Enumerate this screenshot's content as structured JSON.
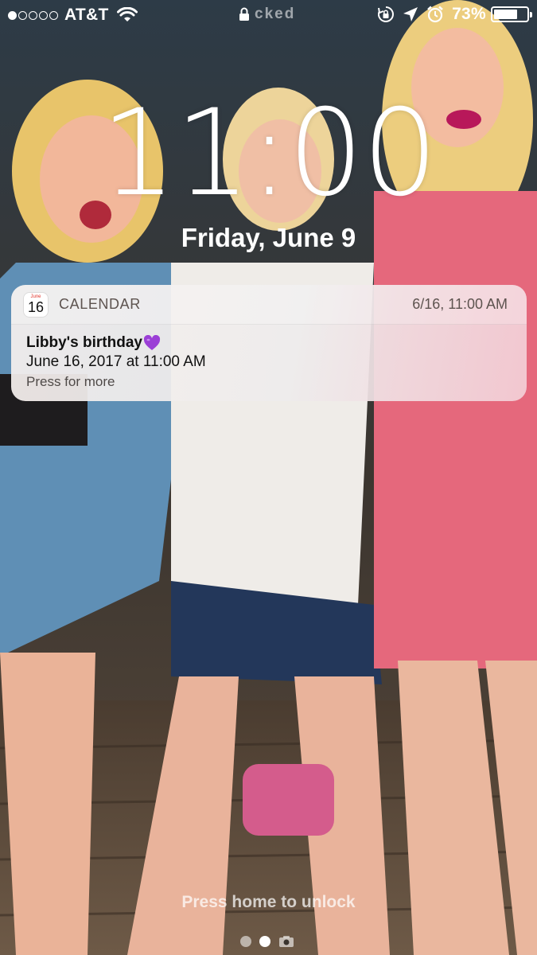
{
  "status_bar": {
    "signal_bars_filled": 1,
    "signal_bars_total": 5,
    "carrier": "AT&T",
    "lock_label": "cked",
    "battery_percent_text": "73%",
    "battery_level": 0.73
  },
  "lock_screen": {
    "time": "11:00",
    "date": "Friday, June 9"
  },
  "notification": {
    "app_icon_day": "June",
    "app_icon_number": "16",
    "app_name": "CALENDAR",
    "time": "6/16, 11:00 AM",
    "title": "Libby's birthday",
    "subtitle": "June 16, 2017 at 11:00 AM",
    "hint": "Press for more"
  },
  "footer": {
    "unlock_hint": "Press home to unlock",
    "pages_total": 2,
    "active_page": 2
  },
  "colors": {
    "heart": "#9b3fd6",
    "icon_red": "#e2342a"
  }
}
